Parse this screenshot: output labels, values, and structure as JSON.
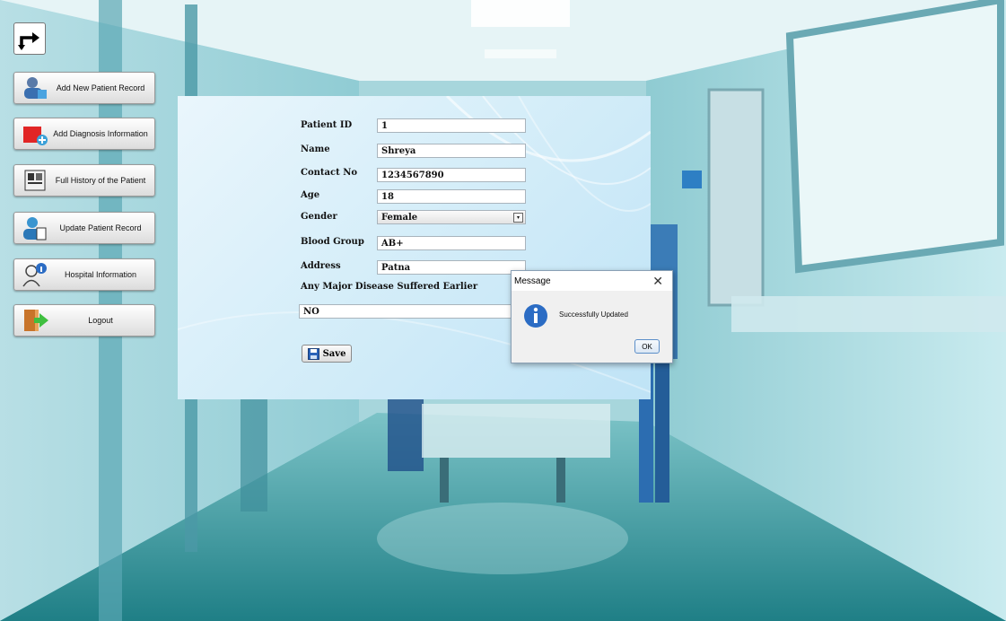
{
  "nav": {
    "items": [
      {
        "label": "Add New Patient Record",
        "icon": "patient-add-icon"
      },
      {
        "label": "Add Diagnosis Information",
        "icon": "diagnosis-add-icon"
      },
      {
        "label": "Full History of the Patient",
        "icon": "patient-history-icon"
      },
      {
        "label": "Update Patient Record",
        "icon": "patient-update-icon"
      },
      {
        "label": "Hospital Information",
        "icon": "hospital-info-icon"
      },
      {
        "label": "Logout",
        "icon": "logout-icon"
      }
    ]
  },
  "form": {
    "patient_id_label": "Patient ID",
    "patient_id": "1",
    "name_label": "Name",
    "name": "Shreya",
    "contact_label": "Contact No",
    "contact": "1234567890",
    "age_label": "Age",
    "age": "18",
    "gender_label": "Gender",
    "gender": "Female",
    "blood_label": "Blood Group",
    "blood": "AB+",
    "address_label": "Address",
    "address": "Patna",
    "disease_label": "Any Major Disease Suffered Earlier",
    "disease": "NO",
    "save_label": "Save"
  },
  "dialog": {
    "title": "Message",
    "message": "Successfully Updated",
    "ok_label": "OK",
    "close_glyph": "✕"
  },
  "colors": {
    "panel": "#d6eef9",
    "info_icon": "#2b6cc4",
    "nurse_scrubs": "#2c6db1"
  }
}
